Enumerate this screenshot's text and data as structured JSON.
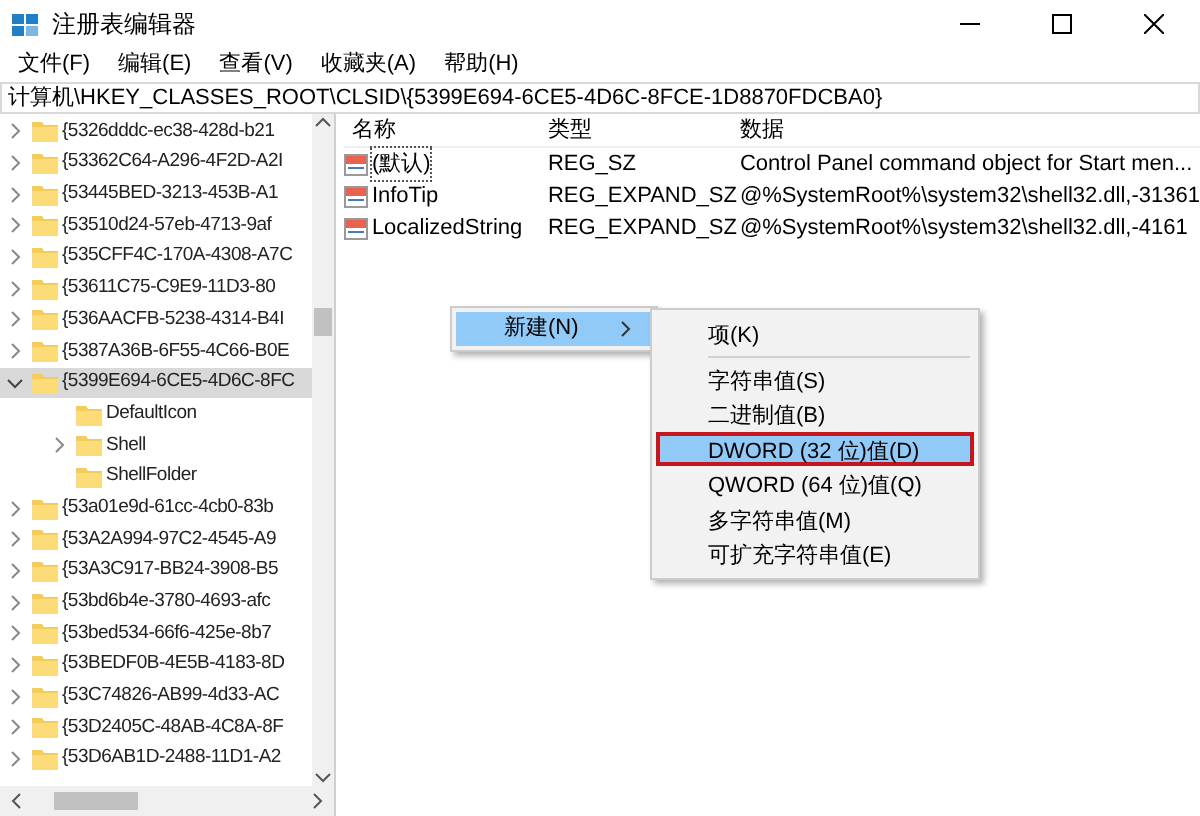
{
  "window": {
    "title": "注册表编辑器"
  },
  "menu": [
    {
      "label": "文件(F)"
    },
    {
      "label": "编辑(E)"
    },
    {
      "label": "查看(V)"
    },
    {
      "label": "收藏夹(A)"
    },
    {
      "label": "帮助(H)"
    }
  ],
  "address": "计算机\\HKEY_CLASSES_ROOT\\CLSID\\{5399E694-6CE5-4D6C-8FCE-1D8870FDCBA0}",
  "tree": [
    {
      "label": "{5326dddc-ec38-428d-b21",
      "expandable": true,
      "expanded": false,
      "selected": false
    },
    {
      "label": "{53362C64-A296-4F2D-A2I",
      "expandable": true,
      "expanded": false,
      "selected": false
    },
    {
      "label": "{53445BED-3213-453B-A1",
      "expandable": true,
      "expanded": false,
      "selected": false
    },
    {
      "label": "{53510d24-57eb-4713-9af",
      "expandable": true,
      "expanded": false,
      "selected": false
    },
    {
      "label": "{535CFF4C-170A-4308-A7C",
      "expandable": true,
      "expanded": false,
      "selected": false
    },
    {
      "label": "{53611C75-C9E9-11D3-80",
      "expandable": true,
      "expanded": false,
      "selected": false
    },
    {
      "label": "{536AACFB-5238-4314-B4I",
      "expandable": true,
      "expanded": false,
      "selected": false
    },
    {
      "label": "{5387A36B-6F55-4C66-B0E",
      "expandable": true,
      "expanded": false,
      "selected": false
    },
    {
      "label": "{5399E694-6CE5-4D6C-8FC",
      "expandable": true,
      "expanded": true,
      "selected": true,
      "children": [
        {
          "label": "DefaultIcon",
          "expandable": false,
          "expanded": false,
          "selected": false
        },
        {
          "label": "Shell",
          "expandable": true,
          "expanded": false,
          "selected": false
        },
        {
          "label": "ShellFolder",
          "expandable": false,
          "expanded": false,
          "selected": false
        }
      ]
    },
    {
      "label": "{53a01e9d-61cc-4cb0-83b",
      "expandable": true,
      "expanded": false,
      "selected": false
    },
    {
      "label": "{53A2A994-97C2-4545-A9",
      "expandable": true,
      "expanded": false,
      "selected": false
    },
    {
      "label": "{53A3C917-BB24-3908-B5",
      "expandable": true,
      "expanded": false,
      "selected": false
    },
    {
      "label": "{53bd6b4e-3780-4693-afc",
      "expandable": true,
      "expanded": false,
      "selected": false
    },
    {
      "label": "{53bed534-66f6-425e-8b7",
      "expandable": true,
      "expanded": false,
      "selected": false
    },
    {
      "label": "{53BEDF0B-4E5B-4183-8D",
      "expandable": true,
      "expanded": false,
      "selected": false
    },
    {
      "label": "{53C74826-AB99-4d33-AC",
      "expandable": true,
      "expanded": false,
      "selected": false
    },
    {
      "label": "{53D2405C-48AB-4C8A-8F",
      "expandable": true,
      "expanded": false,
      "selected": false
    },
    {
      "label": "{53D6AB1D-2488-11D1-A2",
      "expandable": true,
      "expanded": false,
      "selected": false
    }
  ],
  "values": {
    "columns": [
      "名称",
      "类型",
      "数据"
    ],
    "rows": [
      {
        "name": "(默认)",
        "type": "REG_SZ",
        "data": "Control Panel command object for Start men...",
        "focused": true
      },
      {
        "name": "InfoTip",
        "type": "REG_EXPAND_SZ",
        "data": "@%SystemRoot%\\system32\\shell32.dll,-31361",
        "focused": false
      },
      {
        "name": "LocalizedString",
        "type": "REG_EXPAND_SZ",
        "data": "@%SystemRoot%\\system32\\shell32.dll,-4161",
        "focused": false
      }
    ]
  },
  "context_menu": {
    "items": [
      {
        "label": "新建(N)",
        "submenu": true,
        "selected": true
      }
    ],
    "submenu": [
      {
        "kind": "item",
        "label": "项(K)",
        "selected": false,
        "outlined": false
      },
      {
        "kind": "separator"
      },
      {
        "kind": "item",
        "label": "字符串值(S)",
        "selected": false,
        "outlined": false
      },
      {
        "kind": "item",
        "label": "二进制值(B)",
        "selected": false,
        "outlined": false
      },
      {
        "kind": "item",
        "label": "DWORD (32 位)值(D)",
        "selected": true,
        "outlined": true
      },
      {
        "kind": "item",
        "label": "QWORD (64 位)值(Q)",
        "selected": false,
        "outlined": false
      },
      {
        "kind": "item",
        "label": "多字符串值(M)",
        "selected": false,
        "outlined": false
      },
      {
        "kind": "item",
        "label": "可扩充字符串值(E)",
        "selected": false,
        "outlined": false
      }
    ]
  }
}
